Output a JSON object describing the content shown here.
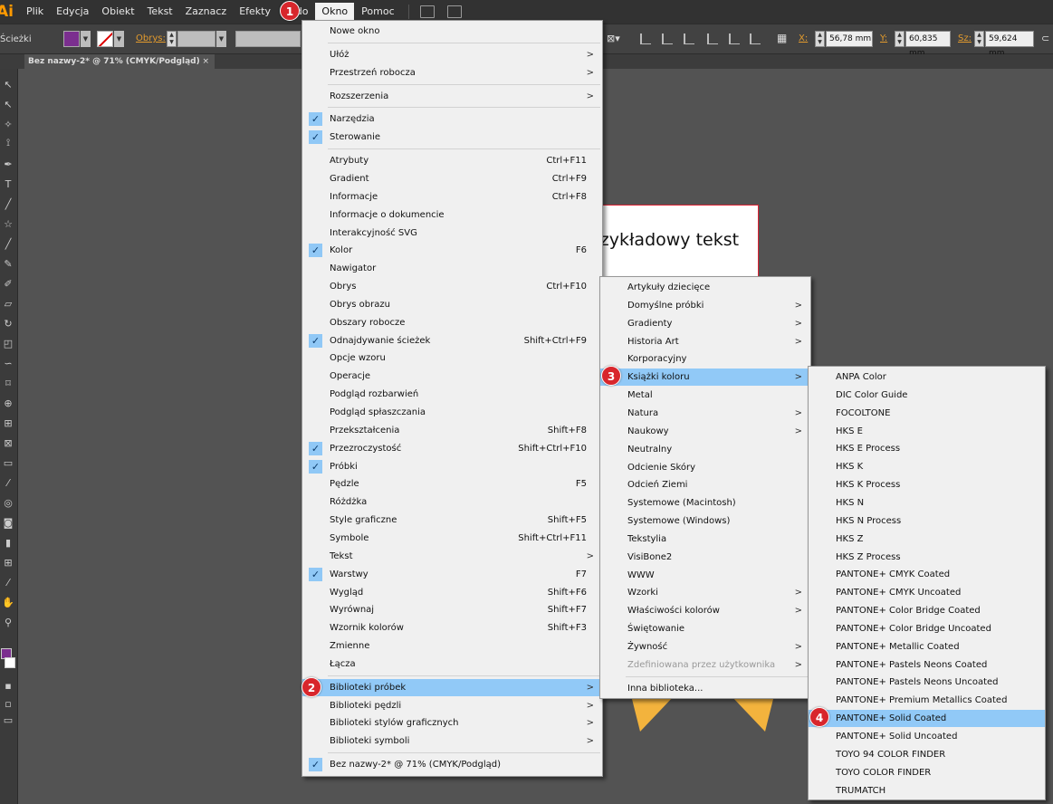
{
  "menubar": {
    "logo": "Ai",
    "items": [
      "Plik",
      "Edycja",
      "Obiekt",
      "Tekst",
      "Zaznacz",
      "Efekty",
      "Wido",
      "Okno",
      "Pomoc"
    ]
  },
  "control": {
    "path_label": "Ścieżki",
    "stroke_label": "Obrys:",
    "x_label": "X:",
    "x_value": "56,78 mm",
    "y_label": "Y:",
    "y_value": "60,835 mm",
    "w_label": "Sz:",
    "w_value": "59,624 mm"
  },
  "doc": {
    "tab_title": "Bez nazwy-2* @ 71% (CMYK/Podgląd)",
    "tab_close": "×",
    "artboard_text": "rzykładowy tekst"
  },
  "badges": [
    "1",
    "2",
    "3",
    "4"
  ],
  "okno_menu": {
    "items": [
      {
        "label": "Nowe okno"
      },
      {
        "label": "Ułóż",
        "arrow": ">"
      },
      {
        "label": "Przestrzeń robocza",
        "arrow": ">"
      },
      {
        "label": "Rozszerzenia",
        "arrow": ">"
      },
      {
        "label": "Narzędzia",
        "check": "✓"
      },
      {
        "label": "Sterowanie",
        "check": "✓"
      },
      {
        "label": "Atrybuty",
        "shortcut": "Ctrl+F11"
      },
      {
        "label": "Gradient",
        "shortcut": "Ctrl+F9"
      },
      {
        "label": "Informacje",
        "shortcut": "Ctrl+F8"
      },
      {
        "label": "Informacje o dokumencie"
      },
      {
        "label": "Interakcyjność SVG"
      },
      {
        "label": "Kolor",
        "shortcut": "F6",
        "check": "✓"
      },
      {
        "label": "Nawigator"
      },
      {
        "label": "Obrys",
        "shortcut": "Ctrl+F10"
      },
      {
        "label": "Obrys obrazu"
      },
      {
        "label": "Obszary robocze"
      },
      {
        "label": "Odnajdywanie ścieżek",
        "shortcut": "Shift+Ctrl+F9",
        "check": "✓"
      },
      {
        "label": "Opcje wzoru"
      },
      {
        "label": "Operacje"
      },
      {
        "label": "Podgląd rozbarwień"
      },
      {
        "label": "Podgląd spłaszczania"
      },
      {
        "label": "Przekształcenia",
        "shortcut": "Shift+F8"
      },
      {
        "label": "Przezroczystość",
        "shortcut": "Shift+Ctrl+F10",
        "check": "✓"
      },
      {
        "label": "Próbki",
        "check": "✓"
      },
      {
        "label": "Pędzle",
        "shortcut": "F5"
      },
      {
        "label": "Różdżka"
      },
      {
        "label": "Style graficzne",
        "shortcut": "Shift+F5"
      },
      {
        "label": "Symbole",
        "shortcut": "Shift+Ctrl+F11"
      },
      {
        "label": "Tekst",
        "arrow": ">"
      },
      {
        "label": "Warstwy",
        "shortcut": "F7",
        "check": "✓"
      },
      {
        "label": "Wygląd",
        "shortcut": "Shift+F6"
      },
      {
        "label": "Wyrównaj",
        "shortcut": "Shift+F7"
      },
      {
        "label": "Wzornik kolorów",
        "shortcut": "Shift+F3"
      },
      {
        "label": "Zmienne"
      },
      {
        "label": "Łącza"
      },
      {
        "label": "Biblioteki próbek",
        "arrow": ">"
      },
      {
        "label": "Biblioteki pędzli",
        "arrow": ">"
      },
      {
        "label": "Biblioteki stylów graficznych",
        "arrow": ">"
      },
      {
        "label": "Biblioteki symboli",
        "arrow": ">"
      },
      {
        "label": "Bez nazwy-2* @ 71% (CMYK/Podgląd)",
        "check": "✓"
      }
    ]
  },
  "swatch_libs_menu": {
    "items": [
      {
        "label": "Artykuły dziecięce"
      },
      {
        "label": "Domyślne próbki",
        "arrow": ">"
      },
      {
        "label": "Gradienty",
        "arrow": ">"
      },
      {
        "label": "Historia Art",
        "arrow": ">"
      },
      {
        "label": "Korporacyjny"
      },
      {
        "label": "Książki koloru",
        "arrow": ">"
      },
      {
        "label": "Metal"
      },
      {
        "label": "Natura",
        "arrow": ">"
      },
      {
        "label": "Naukowy",
        "arrow": ">"
      },
      {
        "label": "Neutralny"
      },
      {
        "label": "Odcienie Skóry"
      },
      {
        "label": "Odcień Ziemi"
      },
      {
        "label": "Systemowe (Macintosh)"
      },
      {
        "label": "Systemowe (Windows)"
      },
      {
        "label": "Tekstylia"
      },
      {
        "label": "VisiBone2"
      },
      {
        "label": "WWW"
      },
      {
        "label": "Wzorki",
        "arrow": ">"
      },
      {
        "label": "Właściwości kolorów",
        "arrow": ">"
      },
      {
        "label": "Świętowanie"
      },
      {
        "label": "Żywność",
        "arrow": ">"
      },
      {
        "label": "Zdefiniowana przez użytkownika",
        "arrow": ">"
      },
      {
        "label": "Inna biblioteka..."
      }
    ]
  },
  "color_books_menu": {
    "items": [
      "ANPA Color",
      "DIC Color Guide",
      "FOCOLTONE",
      "HKS E",
      "HKS E Process",
      "HKS K",
      "HKS K Process",
      "HKS N",
      "HKS N Process",
      "HKS Z",
      "HKS Z Process",
      "PANTONE+ CMYK Coated",
      "PANTONE+ CMYK Uncoated",
      "PANTONE+ Color Bridge Coated",
      "PANTONE+ Color Bridge Uncoated",
      "PANTONE+ Metallic Coated",
      "PANTONE+ Pastels  Neons Coated",
      "PANTONE+ Pastels  Neons Uncoated",
      "PANTONE+ Premium Metallics Coated",
      "PANTONE+ Solid Coated",
      "PANTONE+ Solid Uncoated",
      "TOYO 94 COLOR FINDER",
      "TOYO COLOR FINDER",
      "TRUMATCH"
    ]
  }
}
